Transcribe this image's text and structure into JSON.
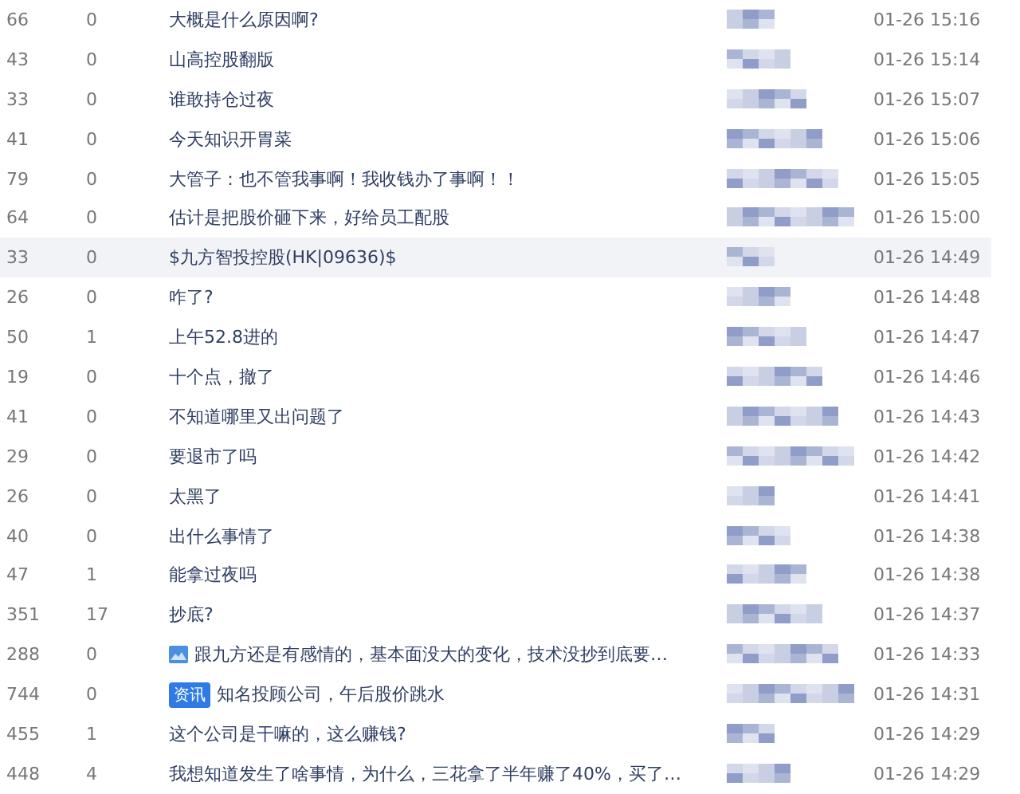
{
  "rows": [
    {
      "reads": "66",
      "comments": "0",
      "kind": "plain",
      "title": "大概是什么原因啊?",
      "time": "01-26 15:16",
      "highlighted": false
    },
    {
      "reads": "43",
      "comments": "0",
      "kind": "plain",
      "title": "山高控股翻版",
      "time": "01-26 15:14",
      "highlighted": false
    },
    {
      "reads": "33",
      "comments": "0",
      "kind": "plain",
      "title": "谁敢持仓过夜",
      "time": "01-26 15:07",
      "highlighted": false
    },
    {
      "reads": "41",
      "comments": "0",
      "kind": "plain",
      "title": "今天知识开胃菜",
      "time": "01-26 15:06",
      "highlighted": false
    },
    {
      "reads": "79",
      "comments": "0",
      "kind": "plain",
      "title": "大管子：也不管我事啊！我收钱办了事啊！！",
      "time": "01-26 15:05",
      "highlighted": false
    },
    {
      "reads": "64",
      "comments": "0",
      "kind": "plain",
      "title": "估计是把股价砸下来，好给员工配股",
      "time": "01-26 15:00",
      "highlighted": false
    },
    {
      "reads": "33",
      "comments": "0",
      "kind": "plain",
      "title": "$九方智投控股(HK|09636)$",
      "time": "01-26 14:49",
      "highlighted": true
    },
    {
      "reads": "26",
      "comments": "0",
      "kind": "plain",
      "title": "咋了?",
      "time": "01-26 14:48",
      "highlighted": false
    },
    {
      "reads": "50",
      "comments": "1",
      "kind": "plain",
      "title": "上午52.8进的",
      "time": "01-26 14:47",
      "highlighted": false
    },
    {
      "reads": "19",
      "comments": "0",
      "kind": "plain",
      "title": "十个点，撤了",
      "time": "01-26 14:46",
      "highlighted": false
    },
    {
      "reads": "41",
      "comments": "0",
      "kind": "plain",
      "title": "不知道哪里又出问题了",
      "time": "01-26 14:43",
      "highlighted": false
    },
    {
      "reads": "29",
      "comments": "0",
      "kind": "plain",
      "title": "要退市了吗",
      "time": "01-26 14:42",
      "highlighted": false
    },
    {
      "reads": "26",
      "comments": "0",
      "kind": "plain",
      "title": "太黑了",
      "time": "01-26 14:41",
      "highlighted": false
    },
    {
      "reads": "40",
      "comments": "0",
      "kind": "plain",
      "title": "出什么事情了",
      "time": "01-26 14:38",
      "highlighted": false
    },
    {
      "reads": "47",
      "comments": "1",
      "kind": "plain",
      "title": "能拿过夜吗",
      "time": "01-26 14:38",
      "highlighted": false
    },
    {
      "reads": "351",
      "comments": "17",
      "kind": "plain",
      "title": "抄底?",
      "time": "01-26 14:37",
      "highlighted": false
    },
    {
      "reads": "288",
      "comments": "0",
      "kind": "image",
      "title": "跟九方还是有感情的，基本面没大的变化，技术没抄到底要…",
      "time": "01-26 14:33",
      "highlighted": false
    },
    {
      "reads": "744",
      "comments": "0",
      "kind": "news",
      "badge": "资讯",
      "title": "知名投顾公司，午后股价跳水",
      "time": "01-26 14:31",
      "highlighted": false
    },
    {
      "reads": "455",
      "comments": "1",
      "kind": "plain",
      "title": "这个公司是干嘛的，这么赚钱?",
      "time": "01-26 14:29",
      "highlighted": false
    },
    {
      "reads": "448",
      "comments": "4",
      "kind": "plain",
      "title": "我想知道发生了啥事情，为什么，三花拿了半年赚了40%，买了…",
      "time": "01-26 14:29",
      "highlighted": false
    }
  ]
}
